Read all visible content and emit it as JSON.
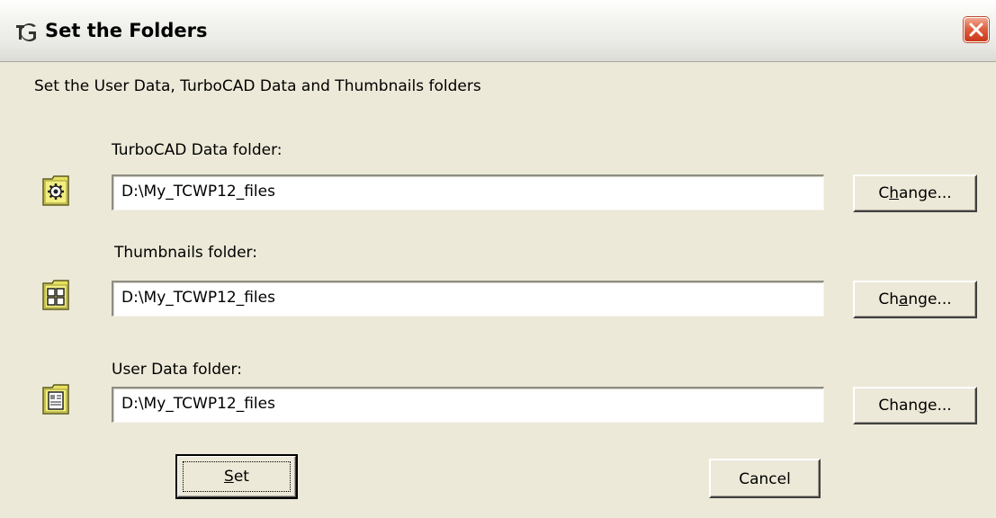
{
  "window": {
    "title": "Set the Folders",
    "app_icon": "turbocad-icon",
    "close_icon": "close-icon"
  },
  "instruction": "Set the User Data, TurboCAD Data and Thumbnails folders",
  "folders": [
    {
      "label": "TurboCAD Data folder:",
      "icon": "gear-folder-icon",
      "value": "D:\\My_TCWP12_files",
      "button_pre": "C",
      "button_u": "h",
      "button_post": "ange..."
    },
    {
      "label": "Thumbnails folder:",
      "icon": "thumbnails-folder-icon",
      "value": "D:\\My_TCWP12_files",
      "button_pre": "Ch",
      "button_u": "a",
      "button_post": "nge..."
    },
    {
      "label": "User Data folder:",
      "icon": "document-folder-icon",
      "value": "D:\\My_TCWP12_files",
      "button_pre": "Chan",
      "button_u": "g",
      "button_post": "e..."
    }
  ],
  "buttons": {
    "set_u": "S",
    "set_rest": "et",
    "cancel": "Cancel"
  },
  "colors": {
    "dialog_bg": "#ece9d8",
    "icon_yellow": "#e8e060",
    "close_red": "#e06040"
  }
}
